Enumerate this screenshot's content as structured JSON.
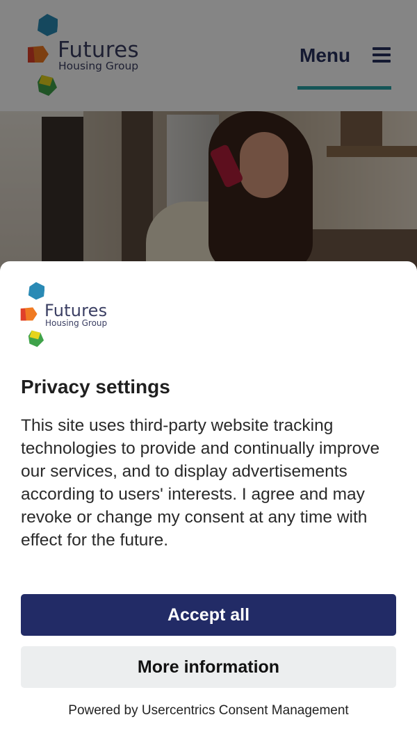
{
  "header": {
    "brand": {
      "name": "Futures",
      "subtitle": "Housing Group"
    },
    "menu": {
      "label": "Menu",
      "icon": "hamburger-menu-icon"
    },
    "colors": {
      "brand_navy": "#27305f",
      "accent_teal": "#2aa3a8"
    }
  },
  "hero": {
    "image": "woman-on-phone-in-kitchen-photo"
  },
  "consent": {
    "brand": {
      "name": "Futures",
      "subtitle": "Housing Group"
    },
    "title": "Privacy settings",
    "body": "This site uses third-party website tracking technologies to provide and continually improve our services, and to display advertisements according to users' interests. I agree and may revoke or change my consent at any time with effect for the future.",
    "accept_label": "Accept all",
    "more_label": "More information",
    "powered_by": "Powered by Usercentrics Consent Management",
    "colors": {
      "accept_bg": "#222b66",
      "more_bg": "#eceeef"
    }
  }
}
